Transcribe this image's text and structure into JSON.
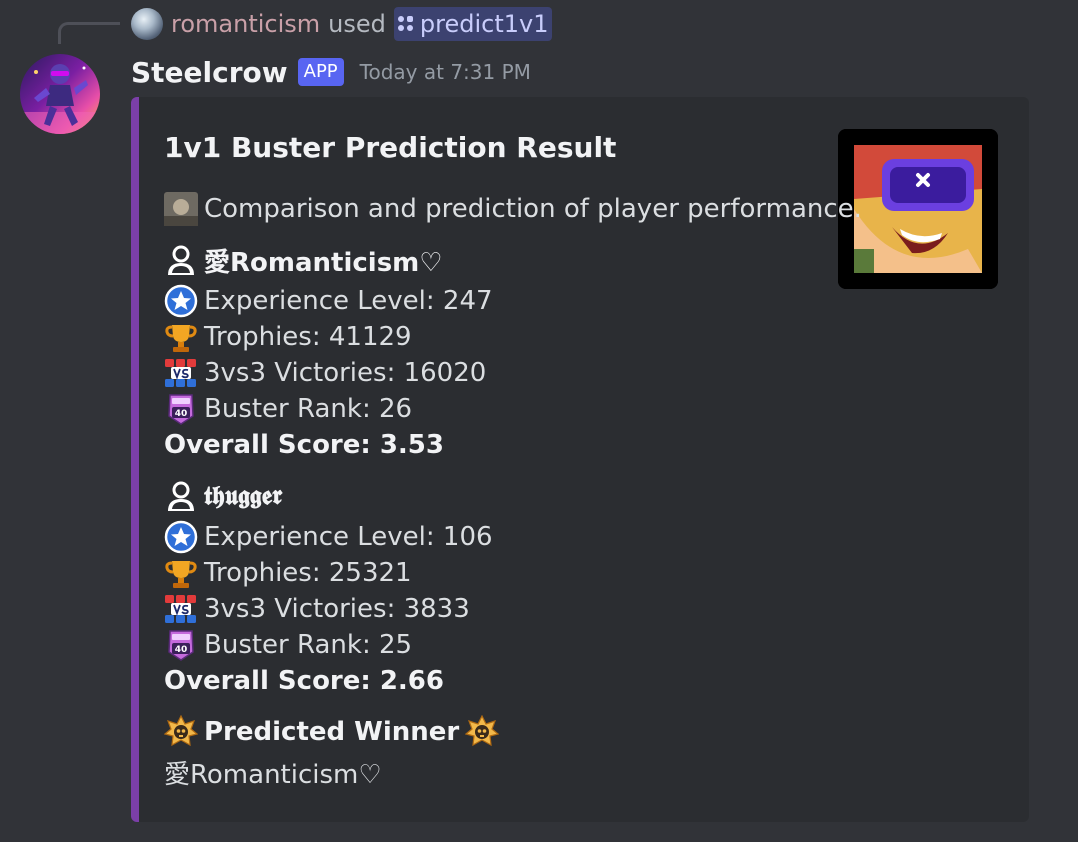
{
  "reply": {
    "user": "romanticism",
    "used_text": "used",
    "command": "predict1v1"
  },
  "message": {
    "author": "Steelcrow",
    "badge": "APP",
    "timestamp": "Today at 7:31 PM"
  },
  "embed": {
    "accent_color": "#7b3fa8",
    "title": "1v1 Buster Prediction Result",
    "description": "Comparison and prediction of player performance.",
    "player1": {
      "name": "愛Romanticism♡",
      "experience": "Experience Level: 247",
      "trophies": "Trophies: 41129",
      "victories": "3vs3 Victories: 16020",
      "rank": "Buster Rank: 26",
      "score": "Overall Score: 3.53"
    },
    "player2": {
      "name": "𝖙𝖍𝖚𝖌𝖌𝖊𝖗",
      "experience": "Experience Level: 106",
      "trophies": "Trophies: 25321",
      "victories": "3vs3 Victories: 3833",
      "rank": "Buster Rank: 25",
      "score": "Overall Score: 2.66"
    },
    "winner": {
      "heading": "Predicted Winner",
      "name": "愛Romanticism♡"
    },
    "icons": {
      "user": "user-silhouette-icon",
      "experience": "star-badge-icon",
      "trophies": "trophy-icon",
      "victories": "vs-icon",
      "rank": "rank-40-icon",
      "winner": "skull-star-icon"
    }
  }
}
